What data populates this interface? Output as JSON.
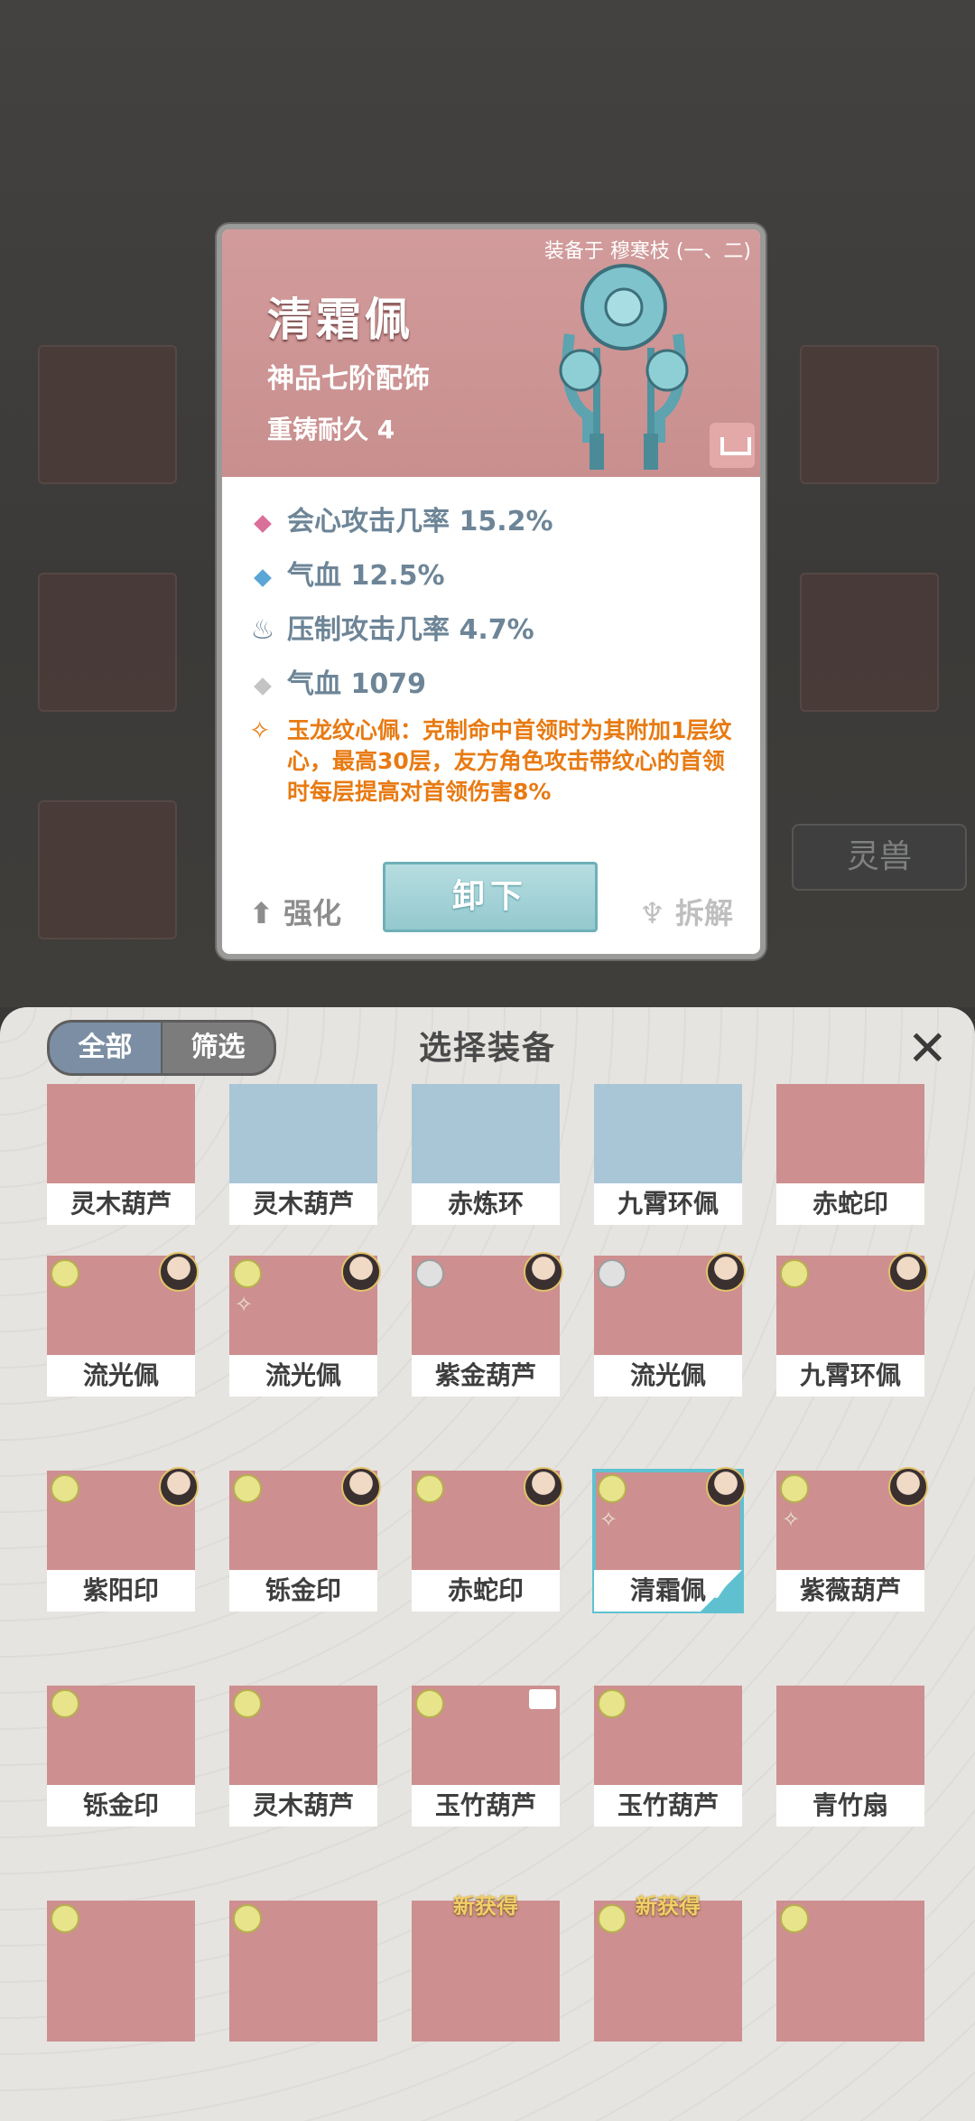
{
  "detail": {
    "equipped_by": "装备于 穆寒枝 (一、二)",
    "name": "清霜佩",
    "grade": "神品七阶配饰",
    "durability": "重铸耐久 4",
    "stats": [
      {
        "icon": "pink-diamond-icon",
        "color": "#d9709a",
        "text": "会心攻击几率 15.2%"
      },
      {
        "icon": "blue-diamond-icon",
        "color": "#5aa6d6",
        "text": "气血 12.5%"
      },
      {
        "icon": "suppress-flame-icon",
        "color": "#6d8597",
        "text": "压制攻击几率 4.7%"
      },
      {
        "icon": "grey-diamond-icon",
        "color": "#c4c4c4",
        "text": "气血 1079"
      }
    ],
    "skill_text": "玉龙纹心佩：克制命中首领时为其附加1层纹心，最高30层，友方角色攻击带纹心的首领时每层提高对首领伤害8%",
    "enhance_label": "强化",
    "unequip_label": "卸下",
    "break_label": "拆解"
  },
  "background": {
    "tab_label": "灵兽"
  },
  "panel": {
    "filter_all": "全部",
    "filter_screen": "筛选",
    "title": "选择装备",
    "close_icon": "close-icon"
  },
  "items": [
    {
      "label": "灵木葫芦"
    },
    {
      "label": "灵木葫芦"
    },
    {
      "label": "赤炼环"
    },
    {
      "label": "九霄环佩"
    },
    {
      "label": "赤蛇印"
    },
    {
      "label": "流光佩"
    },
    {
      "label": "流光佩"
    },
    {
      "label": "紫金葫芦"
    },
    {
      "label": "流光佩"
    },
    {
      "label": "九霄环佩"
    },
    {
      "label": "紫阳印"
    },
    {
      "label": "铄金印"
    },
    {
      "label": "赤蛇印"
    },
    {
      "label": "清霜佩"
    },
    {
      "label": "紫薇葫芦"
    },
    {
      "label": "铄金印"
    },
    {
      "label": "灵木葫芦"
    },
    {
      "label": "玉竹葫芦"
    },
    {
      "label": "玉竹葫芦"
    },
    {
      "label": "青竹扇"
    },
    {
      "label": ""
    },
    {
      "label": ""
    },
    {
      "label": "",
      "tag": "新获得"
    },
    {
      "label": "",
      "tag": "新获得"
    },
    {
      "label": ""
    }
  ]
}
